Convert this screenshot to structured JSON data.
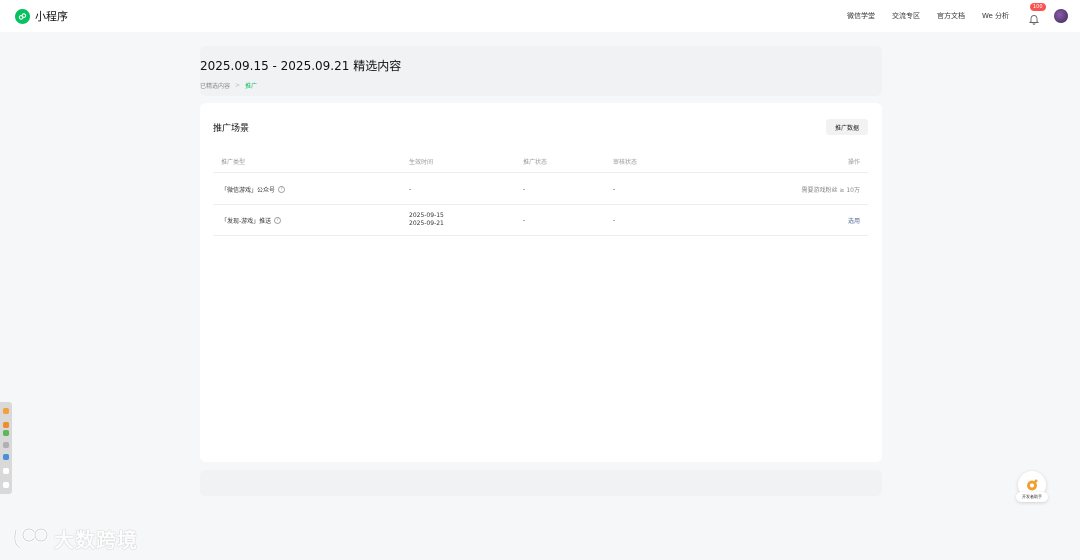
{
  "app": {
    "name": "小程序",
    "brand_color": "#07c160"
  },
  "nav": {
    "links": [
      "微信学堂",
      "交流专区",
      "官方文档",
      "We 分析"
    ],
    "notification_badge": "100"
  },
  "page": {
    "title": "2025.09.15 - 2025.09.21 精选内容",
    "breadcrumb": {
      "parent": "已精选内容",
      "separator": ">",
      "current": "推广"
    }
  },
  "card": {
    "title": "推广场景",
    "action_button": "推广数据",
    "table": {
      "headers": [
        "推广类型",
        "生效时间",
        "推广状态",
        "审核状态",
        "操作"
      ],
      "rows": [
        {
          "type": "「微信游戏」公众号",
          "time_start": "-",
          "time_end": "",
          "promo_status": "-",
          "review_status": "-",
          "action": "需要游戏粉丝 ≥ 10万"
        },
        {
          "type": "「发现-游戏」推送",
          "time_start": "2025-09-15",
          "time_end": "2025-09-21",
          "promo_status": "-",
          "review_status": "-",
          "action": "选用"
        }
      ]
    }
  },
  "helper": {
    "label": "开发者助手"
  },
  "watermark": {
    "text": "大数跨境"
  }
}
